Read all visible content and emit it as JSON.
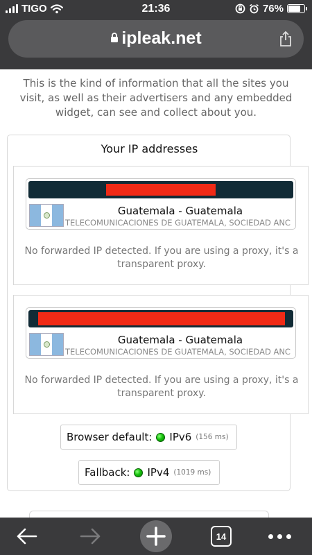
{
  "status_bar": {
    "carrier": "TIGO",
    "time": "21:36",
    "battery": "76%",
    "battery_level": 0.76
  },
  "browser": {
    "url": "ipleak.net",
    "open_tabs": "14",
    "icons": {
      "lock": "lock-icon",
      "share": "share-icon",
      "back": "back-arrow-icon",
      "forward": "forward-arrow-icon",
      "new_tab": "plus-icon",
      "tabs": "tabs-icon",
      "more": "more-icon"
    }
  },
  "intro_text": "This is the kind of information that all the sites you visit, as well as their advertisers and any embedded widget, can see and collect about you.",
  "ip_panel": {
    "title": "Your IP addresses",
    "entries": [
      {
        "location": "Guatemala - Guatemala",
        "isp": "TELECOMUNICACIONES DE GUATEMALA, SOCIEDAD ANC",
        "note": "No forwarded IP detected. If you are using a proxy, it's a transparent proxy."
      },
      {
        "location": "Guatemala - Guatemala",
        "isp": "TELECOMUNICACIONES DE GUATEMALA, SOCIEDAD ANC",
        "note": "No forwarded IP detected. If you are using a proxy, it's a transparent proxy."
      }
    ],
    "browser_default": {
      "label": "Browser default:",
      "protocol": "IPv6",
      "time": "(156 ms)"
    },
    "fallback": {
      "label": "Fallback:",
      "protocol": "IPv4",
      "time": "(1019 ms)"
    }
  },
  "colors": {
    "chrome": "#3a3a3c",
    "url_bar": "#5a5a5c",
    "ip_bar": "#112b36",
    "redaction": "#f02a16",
    "status_ok": "#16c20c"
  }
}
